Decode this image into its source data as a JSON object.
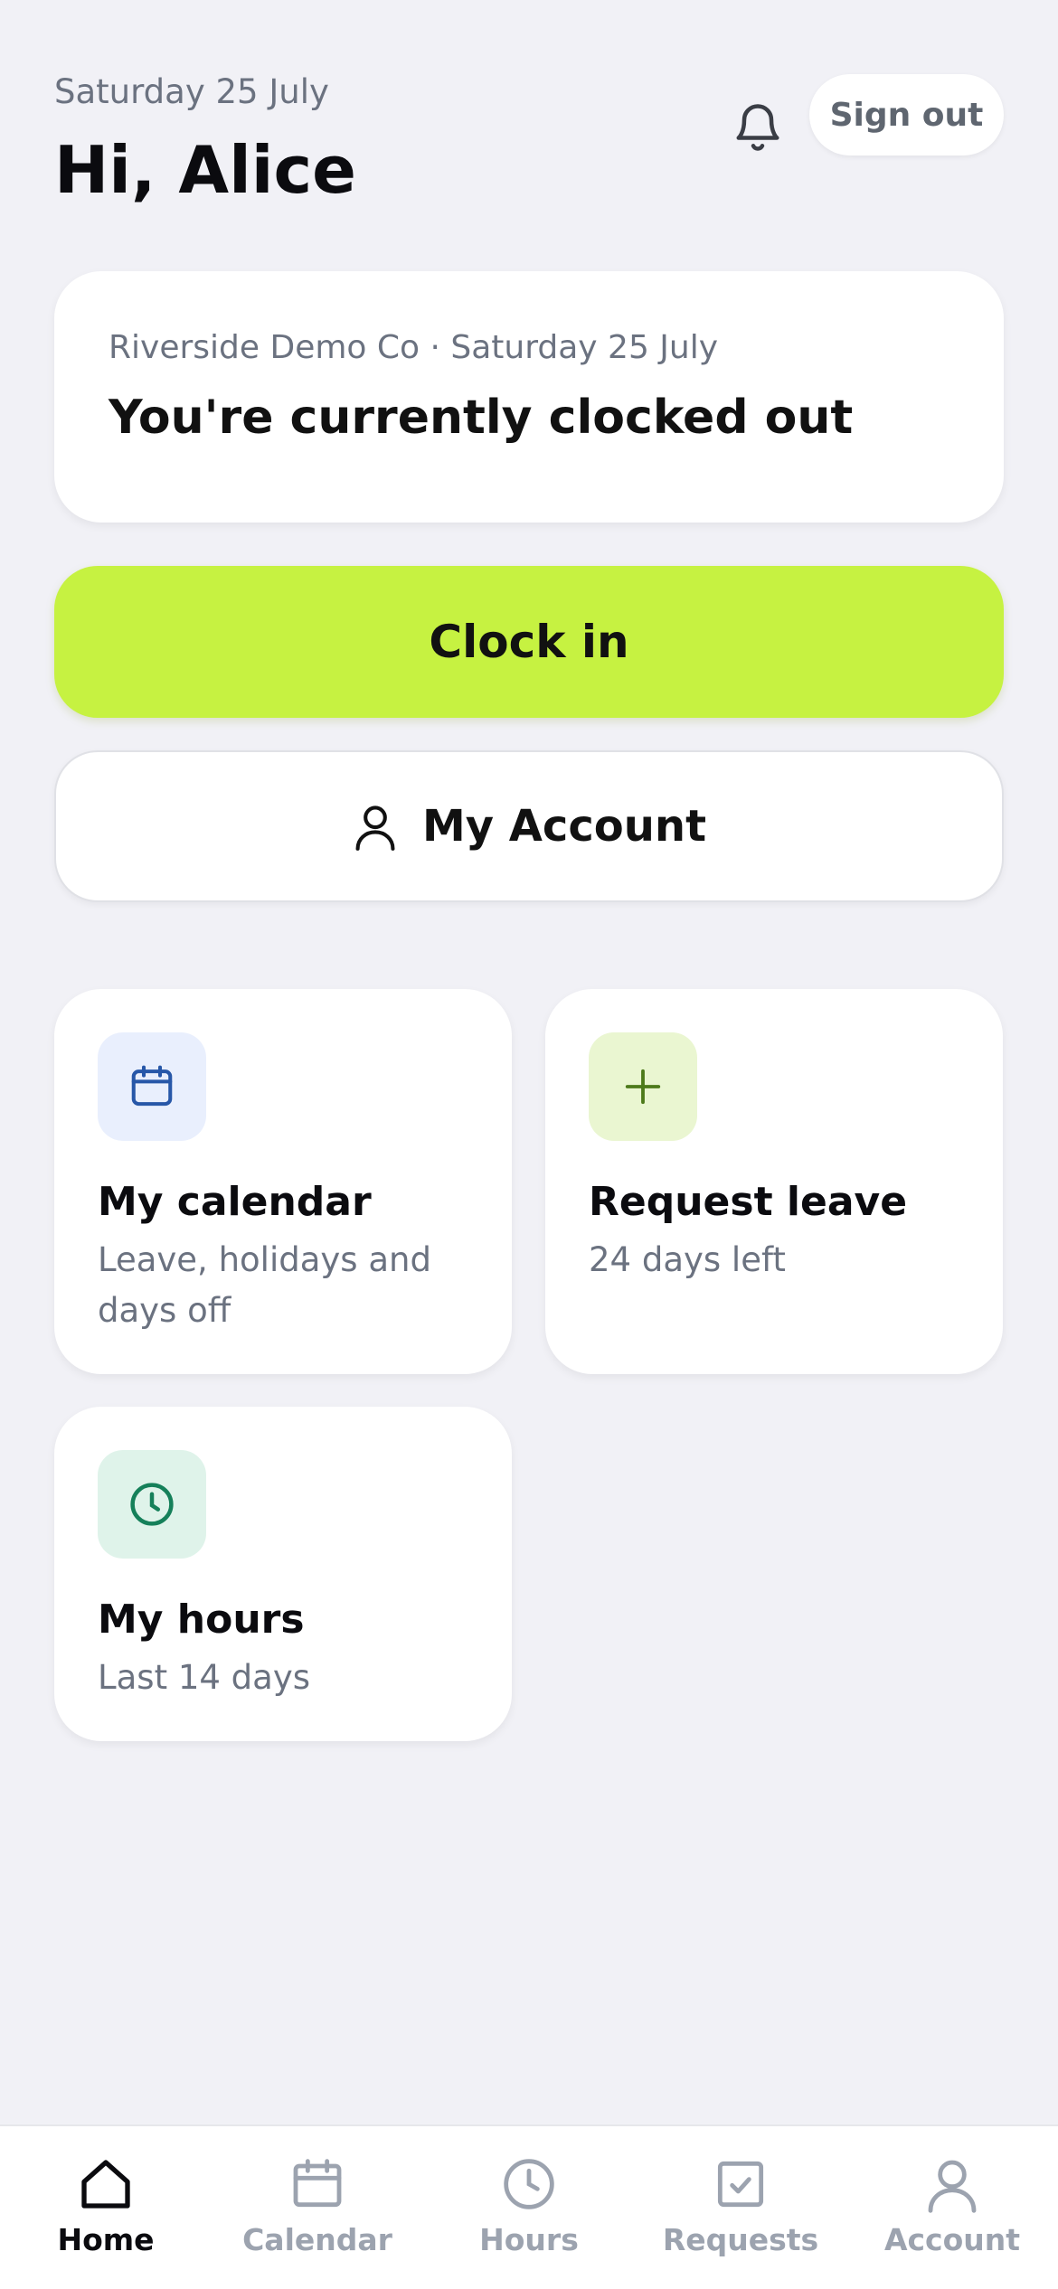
{
  "header": {
    "date": "Saturday 25 July",
    "greeting": "Hi, Alice",
    "signout_label": "Sign out"
  },
  "status": {
    "subtitle": "Riverside Demo Co · Saturday 25 July",
    "title": "You're currently clocked out"
  },
  "actions": {
    "clock_in_label": "Clock in",
    "my_account_label": "My Account"
  },
  "tiles": [
    {
      "title": "My calendar",
      "subtitle": "Leave, holidays and days off",
      "icon": "calendar-icon",
      "icon_bg": "#e9effd",
      "icon_color": "#2757a8"
    },
    {
      "title": "Request leave",
      "subtitle": "24 days left",
      "icon": "plus-icon",
      "icon_bg": "#eaf6d1",
      "icon_color": "#4d7a1a"
    },
    {
      "title": "My hours",
      "subtitle": "Last 14 days",
      "icon": "clock-icon",
      "icon_bg": "#dff3ea",
      "icon_color": "#15805a"
    }
  ],
  "nav": [
    {
      "label": "Home",
      "icon": "home-icon",
      "active": true
    },
    {
      "label": "Calendar",
      "icon": "calendar-icon",
      "active": false
    },
    {
      "label": "Hours",
      "icon": "clock-icon",
      "active": false
    },
    {
      "label": "Requests",
      "icon": "checkbox-icon",
      "active": false
    },
    {
      "label": "Account",
      "icon": "person-icon",
      "active": false
    }
  ],
  "colors": {
    "background": "#f1f1f6",
    "accent": "#c6f241",
    "text_muted": "#6b7280",
    "nav_inactive": "#9ca3af"
  }
}
